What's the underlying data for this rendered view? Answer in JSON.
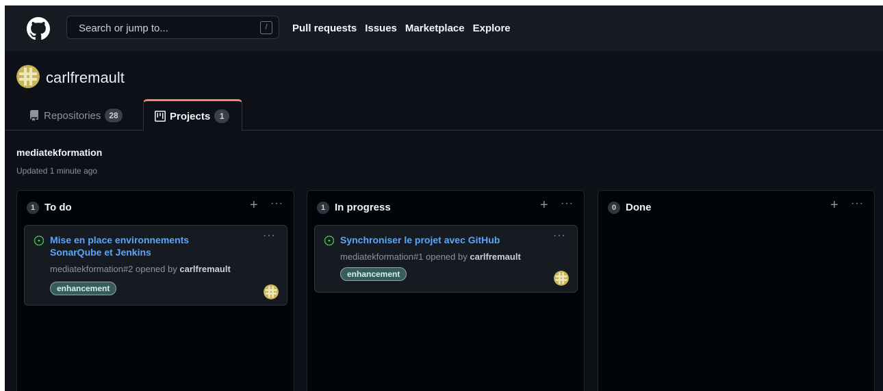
{
  "header": {
    "search_placeholder": "Search or jump to...",
    "search_shortcut": "/",
    "nav": [
      "Pull requests",
      "Issues",
      "Marketplace",
      "Explore"
    ]
  },
  "profile": {
    "username": "carlfremault",
    "tabs": [
      {
        "label": "Repositories",
        "count": "28"
      },
      {
        "label": "Projects",
        "count": "1",
        "active": true
      }
    ]
  },
  "project": {
    "title": "mediatekformation",
    "updated": "Updated 1 minute ago",
    "columns": [
      {
        "name": "To do",
        "count": "1",
        "cards": [
          {
            "title": "Mise en place environnements SonarQube et Jenkins",
            "ref": "mediatekformation#2 opened by",
            "author": "carlfremault",
            "label": "enhancement"
          }
        ]
      },
      {
        "name": "In progress",
        "count": "1",
        "cards": [
          {
            "title": "Synchroniser le projet avec GitHub",
            "ref": "mediatekformation#1 opened by",
            "author": "carlfremault",
            "label": "enhancement"
          }
        ]
      },
      {
        "name": "Done",
        "count": "0",
        "cards": []
      }
    ]
  },
  "ui": {
    "plus": "+",
    "more": "···"
  },
  "colors": {
    "accent": "#58a6ff",
    "tab_active_border": "#f78166",
    "label_bg": "#355d5c",
    "issue_open": "#3fb950"
  }
}
